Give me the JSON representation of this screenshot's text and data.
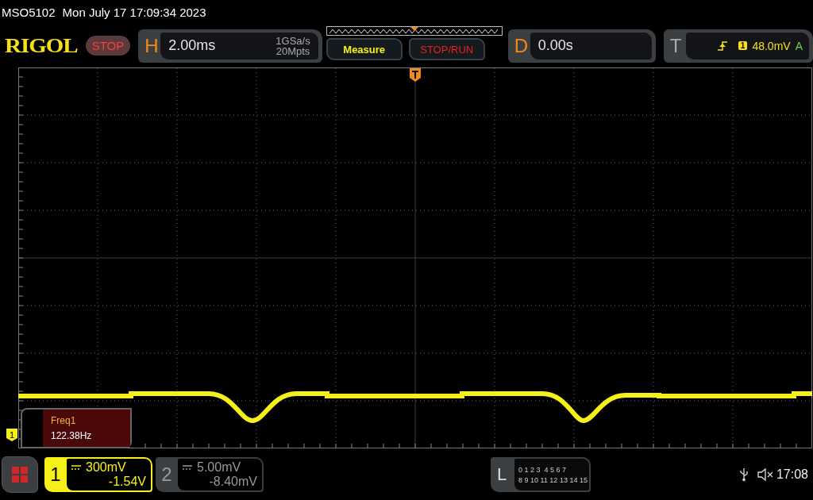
{
  "header": {
    "model": "MSO5102",
    "datetime": "Mon July 17 17:09:34 2023"
  },
  "toolbar": {
    "logo": "RIGOL",
    "run_state": {
      "label": "STOP",
      "kind": "stop"
    },
    "horizontal": {
      "letter": "H",
      "timebase": "2.00ms",
      "sample_rate": "1GSa/s",
      "memory_depth": "20Mpts"
    },
    "buttons": [
      {
        "label": "Measure",
        "kind": "measure"
      },
      {
        "label": "STOP/RUN",
        "kind": "stoprun"
      }
    ],
    "delay": {
      "letter": "D",
      "value": "0.00s"
    },
    "trigger": {
      "letter": "T",
      "source": "1",
      "level": "48.0mV",
      "mode": "A"
    }
  },
  "measurement": {
    "name": "Freq1",
    "value": "122.38Hz"
  },
  "channel_marker": "1",
  "channels": [
    {
      "number": "1",
      "scale": "300mV",
      "offset": "-1.54V",
      "selected": true
    },
    {
      "number": "2",
      "scale": "5.00mV",
      "offset": "-8.40mV",
      "selected": false
    }
  ],
  "logic": {
    "letter": "L",
    "rows": [
      "0 1 2 3  4 5 6 7",
      "8 9 10 11 12 13 14 15"
    ]
  },
  "status": {
    "time": "17:08"
  }
}
